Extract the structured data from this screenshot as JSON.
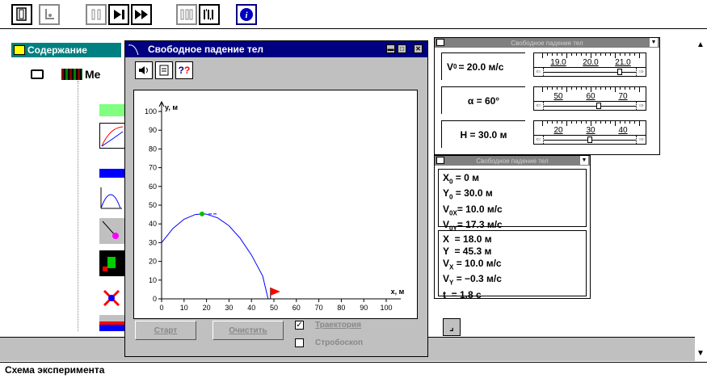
{
  "toolbar": {
    "icons": [
      "exit-icon",
      "footprint-icon",
      "pause-icon",
      "step-icon",
      "fast-forward-icon",
      "step-back-icon",
      "end-icon",
      "info-icon"
    ]
  },
  "background": {
    "toc_tab": "Содержание",
    "books_label": "Ме",
    "status_bar": "Схема эксперимента"
  },
  "main_window": {
    "title": "Свободное падение тел",
    "buttons": {
      "start": "Старт",
      "clear": "Очистить"
    },
    "checkboxes": [
      {
        "label": "Траектория",
        "checked": true
      },
      {
        "label": "Стробоскоп",
        "checked": false
      }
    ]
  },
  "params_window": {
    "title": "Свободное падение тел",
    "params": [
      {
        "label": "V",
        "sub": "0",
        "value": "= 20.0 м/с",
        "scale": [
          "19.0",
          "20.0",
          "21.0"
        ],
        "slider": 0.84
      },
      {
        "label": "α = 60°",
        "sub": "",
        "value": "",
        "scale": [
          "50",
          "60",
          "70"
        ],
        "slider": 0.6
      },
      {
        "label": "H = 30.0 м",
        "sub": "",
        "value": "",
        "scale": [
          "20",
          "30",
          "40"
        ],
        "slider": 0.5
      }
    ]
  },
  "data_window": {
    "title": "Свободное падение тел",
    "initial": [
      {
        "name": "X",
        "sub": "0",
        "value": " = 0 м"
      },
      {
        "name": "Y",
        "sub": "0",
        "value": " = 30.0 м"
      },
      {
        "name": "V",
        "sub": "0X",
        "value": "= 10.0 м/с"
      },
      {
        "name": "V",
        "sub": "0Y",
        "value": "= 17.3 м/с"
      }
    ],
    "current": [
      {
        "name": "X",
        "sub": "",
        "value": "  = 18.0 м"
      },
      {
        "name": "Y",
        "sub": "",
        "value": "  = 45.3 м"
      },
      {
        "name": "V",
        "sub": "X",
        "value": " = 10.0 м/с"
      },
      {
        "name": "V",
        "sub": "Y",
        "value": " = −0.3 м/с"
      },
      {
        "name": "t",
        "sub": "",
        "value": "  = 1.8 с"
      }
    ]
  },
  "chart_data": {
    "type": "line",
    "xlabel": "x, м",
    "ylabel": "y, м",
    "xlim": [
      0,
      100
    ],
    "ylim": [
      0,
      100
    ],
    "xticks": [
      0,
      10,
      20,
      30,
      40,
      50,
      60,
      70,
      80,
      90,
      100
    ],
    "yticks": [
      0,
      10,
      20,
      30,
      40,
      50,
      60,
      70,
      80,
      90,
      100
    ],
    "series": [
      {
        "x": [
          0,
          5,
          10,
          15,
          18,
          20,
          25,
          30,
          35,
          40,
          45,
          47.4
        ],
        "y": [
          30,
          37.5,
          42.5,
          45,
          45.3,
          45.2,
          43.2,
          39.0,
          32.3,
          23.4,
          12.2,
          0
        ]
      }
    ],
    "marker": {
      "x": 18,
      "y": 45.3
    },
    "flag": {
      "x": 48.5,
      "y": 0
    },
    "colors": {
      "line": "#0000ff",
      "marker": "#00c000",
      "flag": "#ff0000"
    }
  }
}
